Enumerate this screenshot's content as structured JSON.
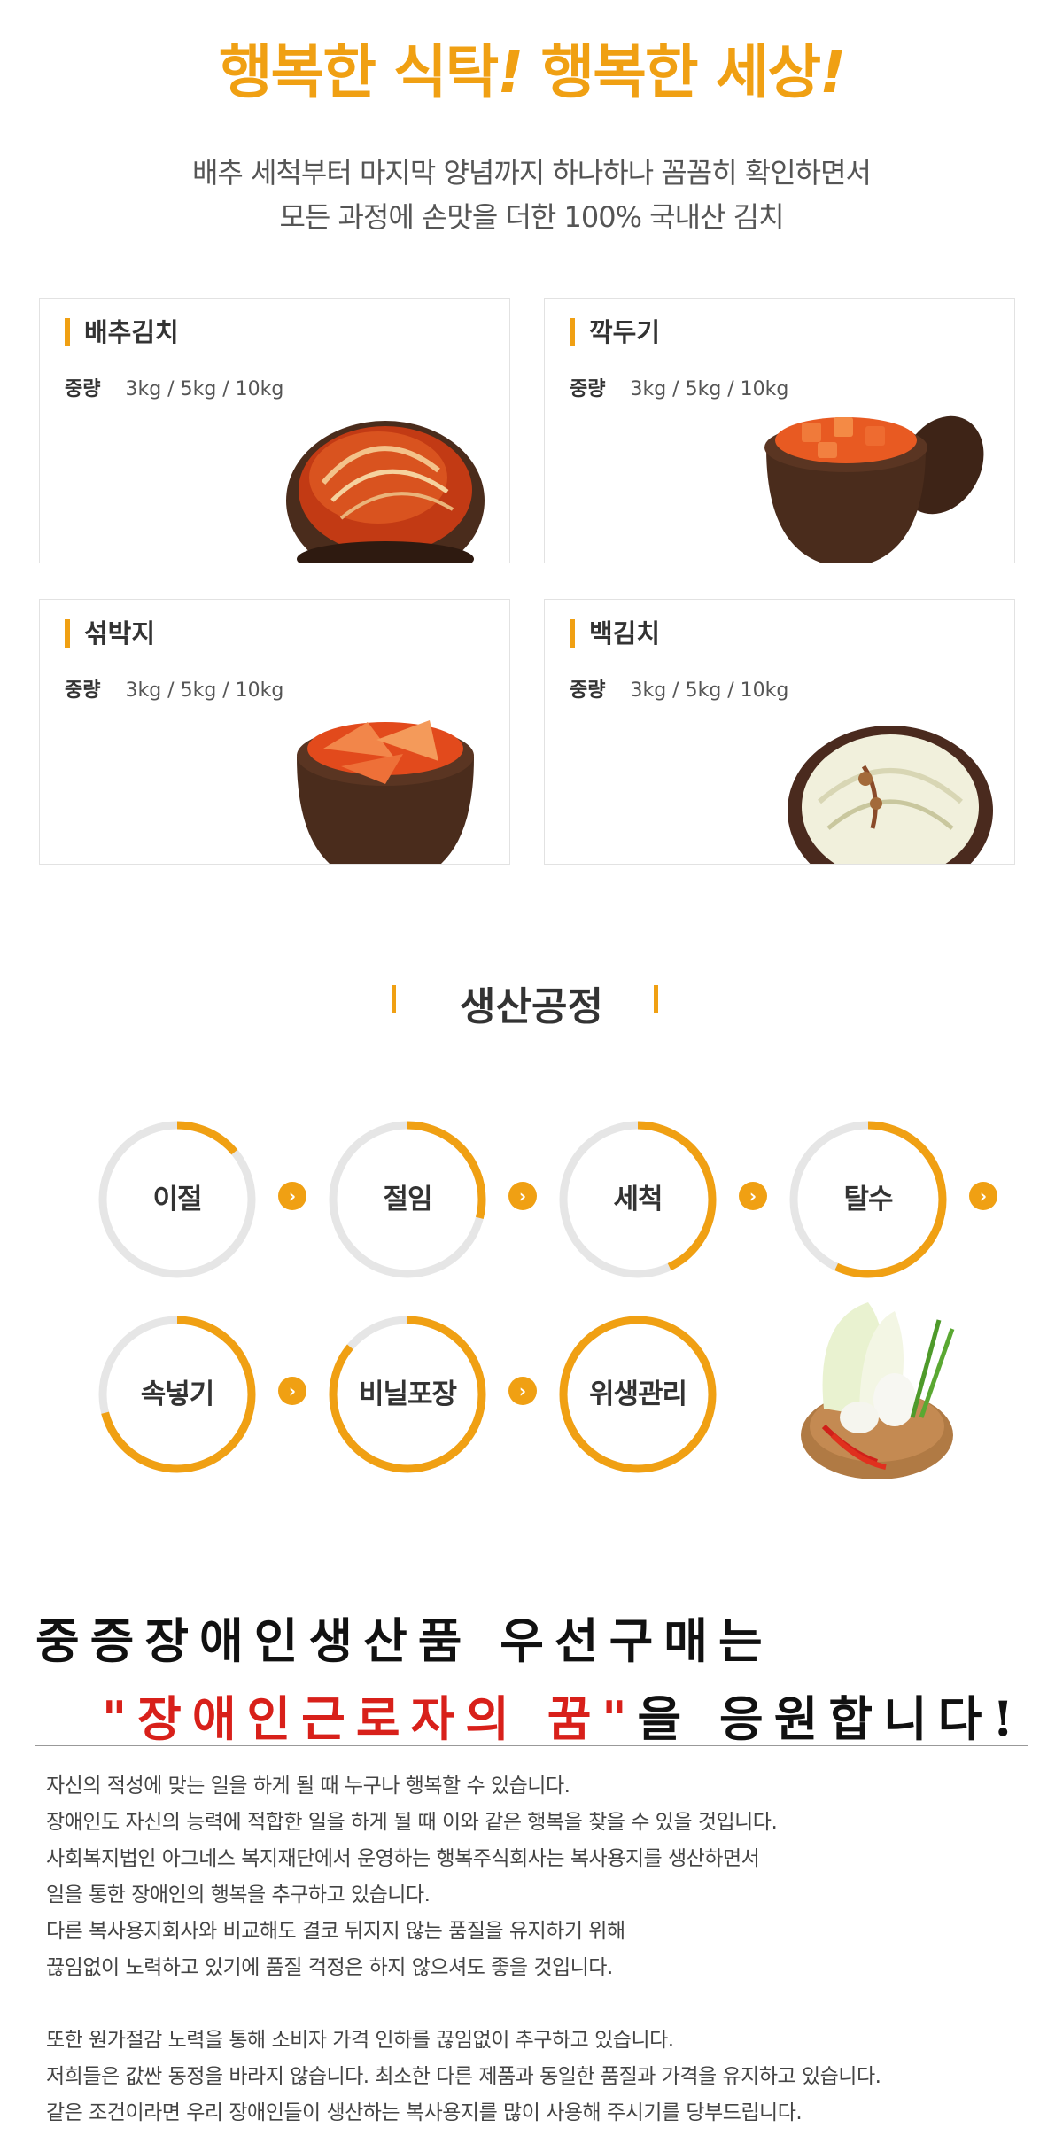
{
  "hero": {
    "title_part1": "행복한 식탁",
    "title_ex1": "!",
    "title_part2": " 행복한 세상",
    "title_ex2": "!",
    "intro_line1": "배추 세척부터 마지막 양념까지 하나하나 꼼꼼히 확인하면서",
    "intro_line2": "모든 과정에 손맛을 더한 100% 국내산 김치"
  },
  "products": [
    {
      "name": "배추김치",
      "weight_label": "중량",
      "weight_value": "3kg / 5kg / 10kg"
    },
    {
      "name": "깍두기",
      "weight_label": "중량",
      "weight_value": "3kg / 5kg / 10kg"
    },
    {
      "name": "섞박지",
      "weight_label": "중량",
      "weight_value": "3kg / 5kg / 10kg"
    },
    {
      "name": "백김치",
      "weight_label": "중량",
      "weight_value": "3kg / 5kg / 10kg"
    }
  ],
  "process": {
    "title": "생산공정",
    "steps": [
      {
        "label": "이절",
        "progress": 0.14
      },
      {
        "label": "절임",
        "progress": 0.29
      },
      {
        "label": "세척",
        "progress": 0.43
      },
      {
        "label": "탈수",
        "progress": 0.57
      },
      {
        "label": "속넣기",
        "progress": 0.71
      },
      {
        "label": "비닐포장",
        "progress": 0.86
      },
      {
        "label": "위생관리",
        "progress": 1.0
      }
    ],
    "arrow_glyph": "›"
  },
  "campaign": {
    "line1": "중증장애인생산품 우선구매는",
    "quote_open": "\"",
    "quote_text": "장애인근로자의 꿈",
    "quote_close": "\"",
    "line2_rest": "을 응원합니다!"
  },
  "body": {
    "para1": [
      "자신의 적성에 맞는 일을 하게 될 때 누구나 행복할 수 있습니다.",
      "장애인도 자신의 능력에 적합한 일을 하게 될 때 이와 같은 행복을 찾을 수 있을 것입니다.",
      "사회복지법인 아그네스 복지재단에서 운영하는 행복주식회사는 복사용지를 생산하면서",
      "일을 통한 장애인의 행복을 추구하고 있습니다.",
      "다른 복사용지회사와 비교해도 결코 뒤지지 않는 품질을 유지하기 위해",
      "끊임없이 노력하고 있기에 품질 걱정은 하지 않으셔도 좋을 것입니다."
    ],
    "para2": [
      "또한 원가절감 노력을 통해 소비자 가격 인하를 끊임없이 추구하고 있습니다.",
      "저희들은 값싼 동정을 바라지 않습니다. 최소한 다른 제품과 동일한 품질과 가격을 유지하고 있습니다.",
      "같은 조건이라면 우리 장애인들이 생산하는 복사용지를 많이 사용해 주시기를 당부드립니다."
    ]
  },
  "colors": {
    "accent": "#f0a013",
    "ring_track": "#e6e6e6",
    "red": "#d8201a"
  }
}
